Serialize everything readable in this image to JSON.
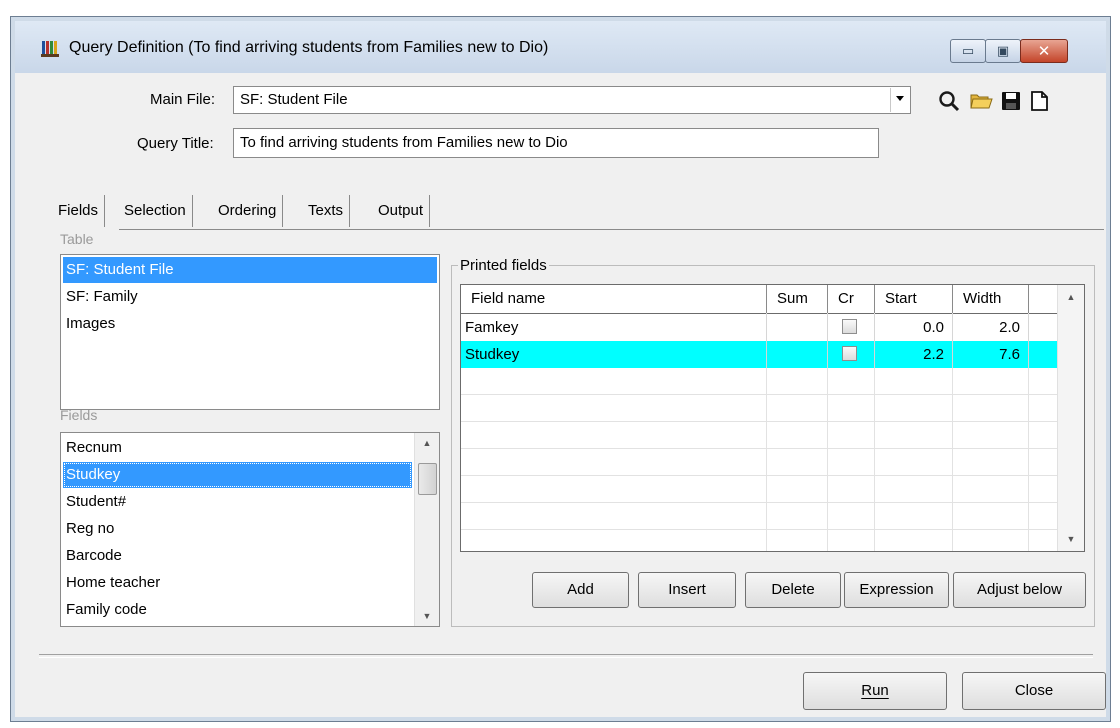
{
  "window": {
    "title": "Query Definition (To find arriving students from Families new to Dio)",
    "caption_minimize": "▭",
    "caption_restore": "▣",
    "caption_close": "✕"
  },
  "header": {
    "main_file_label": "Main File:",
    "main_file_value": "SF: Student File",
    "query_title_label": "Query Title:",
    "query_title_value": "To find arriving students from Families new to Dio"
  },
  "toolbar_icons": [
    "search-icon",
    "open-folder-icon",
    "save-icon",
    "new-document-icon"
  ],
  "tabs": [
    {
      "label": "Fields",
      "active": true
    },
    {
      "label": "Selection",
      "active": false
    },
    {
      "label": "Ordering",
      "active": false
    },
    {
      "label": "Texts",
      "active": false
    },
    {
      "label": "Output",
      "active": false
    }
  ],
  "table_section": {
    "caption": "Table",
    "items": [
      "SF: Student File",
      "SF: Family",
      "Images"
    ],
    "selected_index": 0
  },
  "fields_section": {
    "caption": "Fields",
    "items": [
      "Recnum",
      "Studkey",
      "Student#",
      "Reg no",
      "Barcode",
      "Home teacher",
      "Family code"
    ],
    "selected_index": 1
  },
  "printed_fields": {
    "caption": "Printed fields",
    "columns": [
      "Field name",
      "Sum",
      "Cr",
      "Start",
      "Width"
    ],
    "rows": [
      {
        "field_name": "Famkey",
        "sum": "",
        "cr": false,
        "start": "0.0",
        "width": "2.0",
        "highlighted": false
      },
      {
        "field_name": "Studkey",
        "sum": "",
        "cr": false,
        "start": "2.2",
        "width": "7.6",
        "highlighted": true
      }
    ],
    "buttons": [
      "Add",
      "Insert",
      "Delete",
      "Expression",
      "Adjust below"
    ]
  },
  "footer": {
    "run_label": "Run",
    "close_label": "Close"
  },
  "colors": {
    "selection": "#3399ff",
    "highlight_row": "#00ffff",
    "close_button": "#c4452a"
  }
}
